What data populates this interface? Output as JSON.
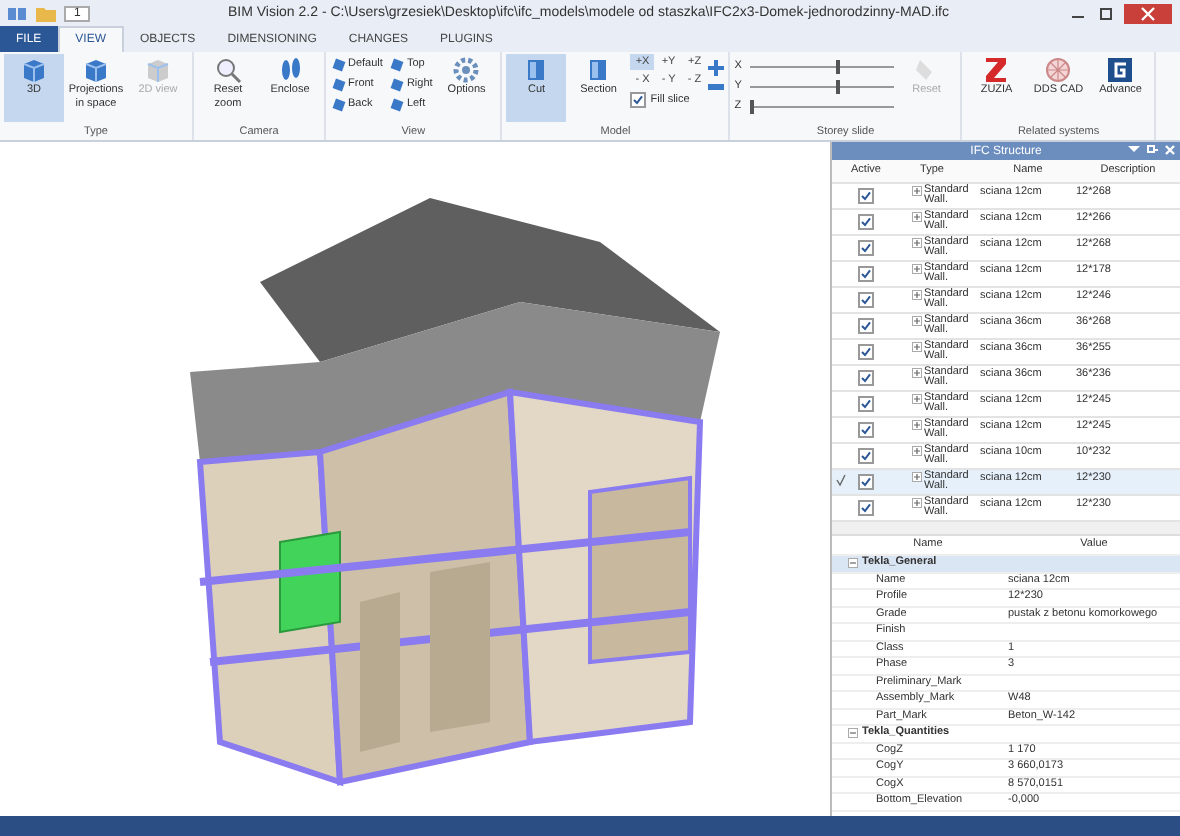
{
  "window": {
    "title": "BIM Vision 2.2 - C:\\Users\\grzesiek\\Desktop\\ifc\\ifc_models\\modele od staszka\\IFC2x3-Domek-jednorodzinny-MAD.ifc",
    "quick_access_value": "1"
  },
  "tabs": [
    {
      "label": "FILE",
      "kind": "file",
      "selected": false
    },
    {
      "label": "VIEW",
      "kind": "tab",
      "selected": true
    },
    {
      "label": "OBJECTS",
      "kind": "tab",
      "selected": false
    },
    {
      "label": "DIMENSIONING",
      "kind": "tab",
      "selected": false
    },
    {
      "label": "CHANGES",
      "kind": "tab",
      "selected": false
    },
    {
      "label": "PLUGINS",
      "kind": "tab",
      "selected": false
    }
  ],
  "ribbon": {
    "type_group": {
      "label": "Type",
      "buttons": [
        {
          "label": "3D",
          "selected": true,
          "disabled": false
        },
        {
          "label": "Projections in space",
          "selected": false,
          "disabled": false
        },
        {
          "label": "2D view",
          "selected": false,
          "disabled": true
        }
      ]
    },
    "camera_group": {
      "label": "Camera",
      "buttons": [
        {
          "label": "Reset zoom"
        },
        {
          "label": "Enclose"
        }
      ]
    },
    "view_group": {
      "label": "View",
      "views": [
        "Default",
        "Top",
        "Front",
        "Right",
        "Back",
        "Left"
      ],
      "options": "Options"
    },
    "model_group": {
      "label": "Model",
      "buttons": [
        {
          "label": "Cut",
          "selected": true
        },
        {
          "label": "Section",
          "selected": false
        }
      ],
      "axes": [
        {
          "label": "+X",
          "selected": true
        },
        {
          "label": "+Y",
          "selected": false
        },
        {
          "label": "+Z",
          "selected": false
        },
        {
          "label": "- X",
          "selected": false
        },
        {
          "label": "- Y",
          "selected": false
        },
        {
          "label": "- Z",
          "selected": false
        }
      ],
      "fill_slice": {
        "label": "Fill slice",
        "checked": true
      }
    },
    "storey_group": {
      "label": "Storey slide",
      "sliders": [
        {
          "axis": "X",
          "level": 0.6
        },
        {
          "axis": "Y",
          "level": 0.6
        },
        {
          "axis": "Z",
          "level": 0.0
        }
      ],
      "reset": {
        "label": "Reset",
        "disabled": true
      }
    },
    "related_group": {
      "label": "Related systems",
      "systems": [
        {
          "label": "ZUZIA",
          "kind": "zuzia"
        },
        {
          "label": "DDS CAD",
          "kind": "dds"
        },
        {
          "label": "Advance",
          "kind": "advance"
        }
      ]
    }
  },
  "ifc_structure": {
    "title": "IFC Structure",
    "columns": [
      "Active",
      "Type",
      "Name",
      "Description"
    ],
    "rows": [
      {
        "active": true,
        "selected": false,
        "type": "Standard Wall.",
        "name": "sciana 12cm",
        "description": "12*268"
      },
      {
        "active": true,
        "selected": false,
        "type": "Standard Wall.",
        "name": "sciana 12cm",
        "description": "12*266"
      },
      {
        "active": true,
        "selected": false,
        "type": "Standard Wall.",
        "name": "sciana 12cm",
        "description": "12*268"
      },
      {
        "active": true,
        "selected": false,
        "type": "Standard Wall.",
        "name": "sciana 12cm",
        "description": "12*178"
      },
      {
        "active": true,
        "selected": false,
        "type": "Standard Wall.",
        "name": "sciana 12cm",
        "description": "12*246"
      },
      {
        "active": true,
        "selected": false,
        "type": "Standard Wall.",
        "name": "sciana 36cm",
        "description": "36*268"
      },
      {
        "active": true,
        "selected": false,
        "type": "Standard Wall.",
        "name": "sciana 36cm",
        "description": "36*255"
      },
      {
        "active": true,
        "selected": false,
        "type": "Standard Wall.",
        "name": "sciana 36cm",
        "description": "36*236"
      },
      {
        "active": true,
        "selected": false,
        "type": "Standard Wall.",
        "name": "sciana 12cm",
        "description": "12*245"
      },
      {
        "active": true,
        "selected": false,
        "type": "Standard Wall.",
        "name": "sciana 12cm",
        "description": "12*245"
      },
      {
        "active": true,
        "selected": false,
        "type": "Standard Wall.",
        "name": "sciana 10cm",
        "description": "10*232"
      },
      {
        "active": true,
        "selected": true,
        "type": "Standard Wall.",
        "name": "sciana 12cm",
        "description": "12*230"
      },
      {
        "active": true,
        "selected": false,
        "type": "Standard Wall.",
        "name": "sciana 12cm",
        "description": "12*230"
      }
    ]
  },
  "properties": {
    "columns": [
      "Name",
      "Value"
    ],
    "groups": [
      {
        "name": "Tekla_General",
        "expanded": true,
        "selected": true,
        "rows": [
          {
            "name": "Name",
            "value": "sciana 12cm"
          },
          {
            "name": "Profile",
            "value": "12*230"
          },
          {
            "name": "Grade",
            "value": "pustak z betonu komorkowego"
          },
          {
            "name": "Finish"
          },
          {
            "name": "Class",
            "value": "1"
          },
          {
            "name": "Phase",
            "value": "3"
          },
          {
            "name": "Preliminary_Mark"
          },
          {
            "name": "Assembly_Mark",
            "value": "W48"
          },
          {
            "name": "Part_Mark",
            "value": "Beton_W-142"
          }
        ]
      },
      {
        "name": "Tekla_Quantities",
        "expanded": true,
        "selected": false,
        "rows": [
          {
            "name": "CogZ",
            "value": "1 170"
          },
          {
            "name": "CogY",
            "value": "3 660,0173"
          },
          {
            "name": "CogX",
            "value": "8 570,0151"
          },
          {
            "name": "Bottom_Elevation",
            "value": "-0,000"
          }
        ]
      }
    ]
  }
}
